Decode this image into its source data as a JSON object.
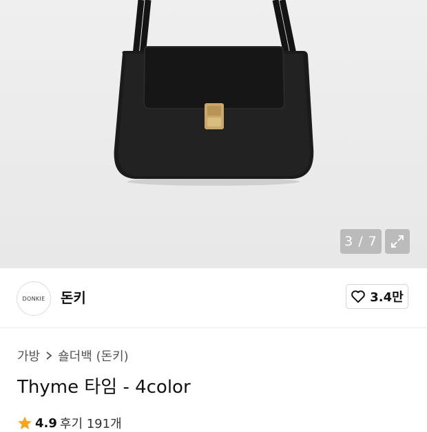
{
  "gallery": {
    "counter": "3 / 7"
  },
  "seller": {
    "logo_text": "DONKIE",
    "name": "돈키",
    "likes": "3.4만"
  },
  "breadcrumb": {
    "category": "가방",
    "separator": ">",
    "subcategory": "숄더백 (돈키)"
  },
  "product": {
    "title": "Thyme 타임 - 4color"
  },
  "rating": {
    "score": "4.9",
    "reviews": "후기 191개"
  },
  "colors": {
    "star": "#f7a51c",
    "bag": "#1a1a1a",
    "clasp": "#c9a96a"
  }
}
